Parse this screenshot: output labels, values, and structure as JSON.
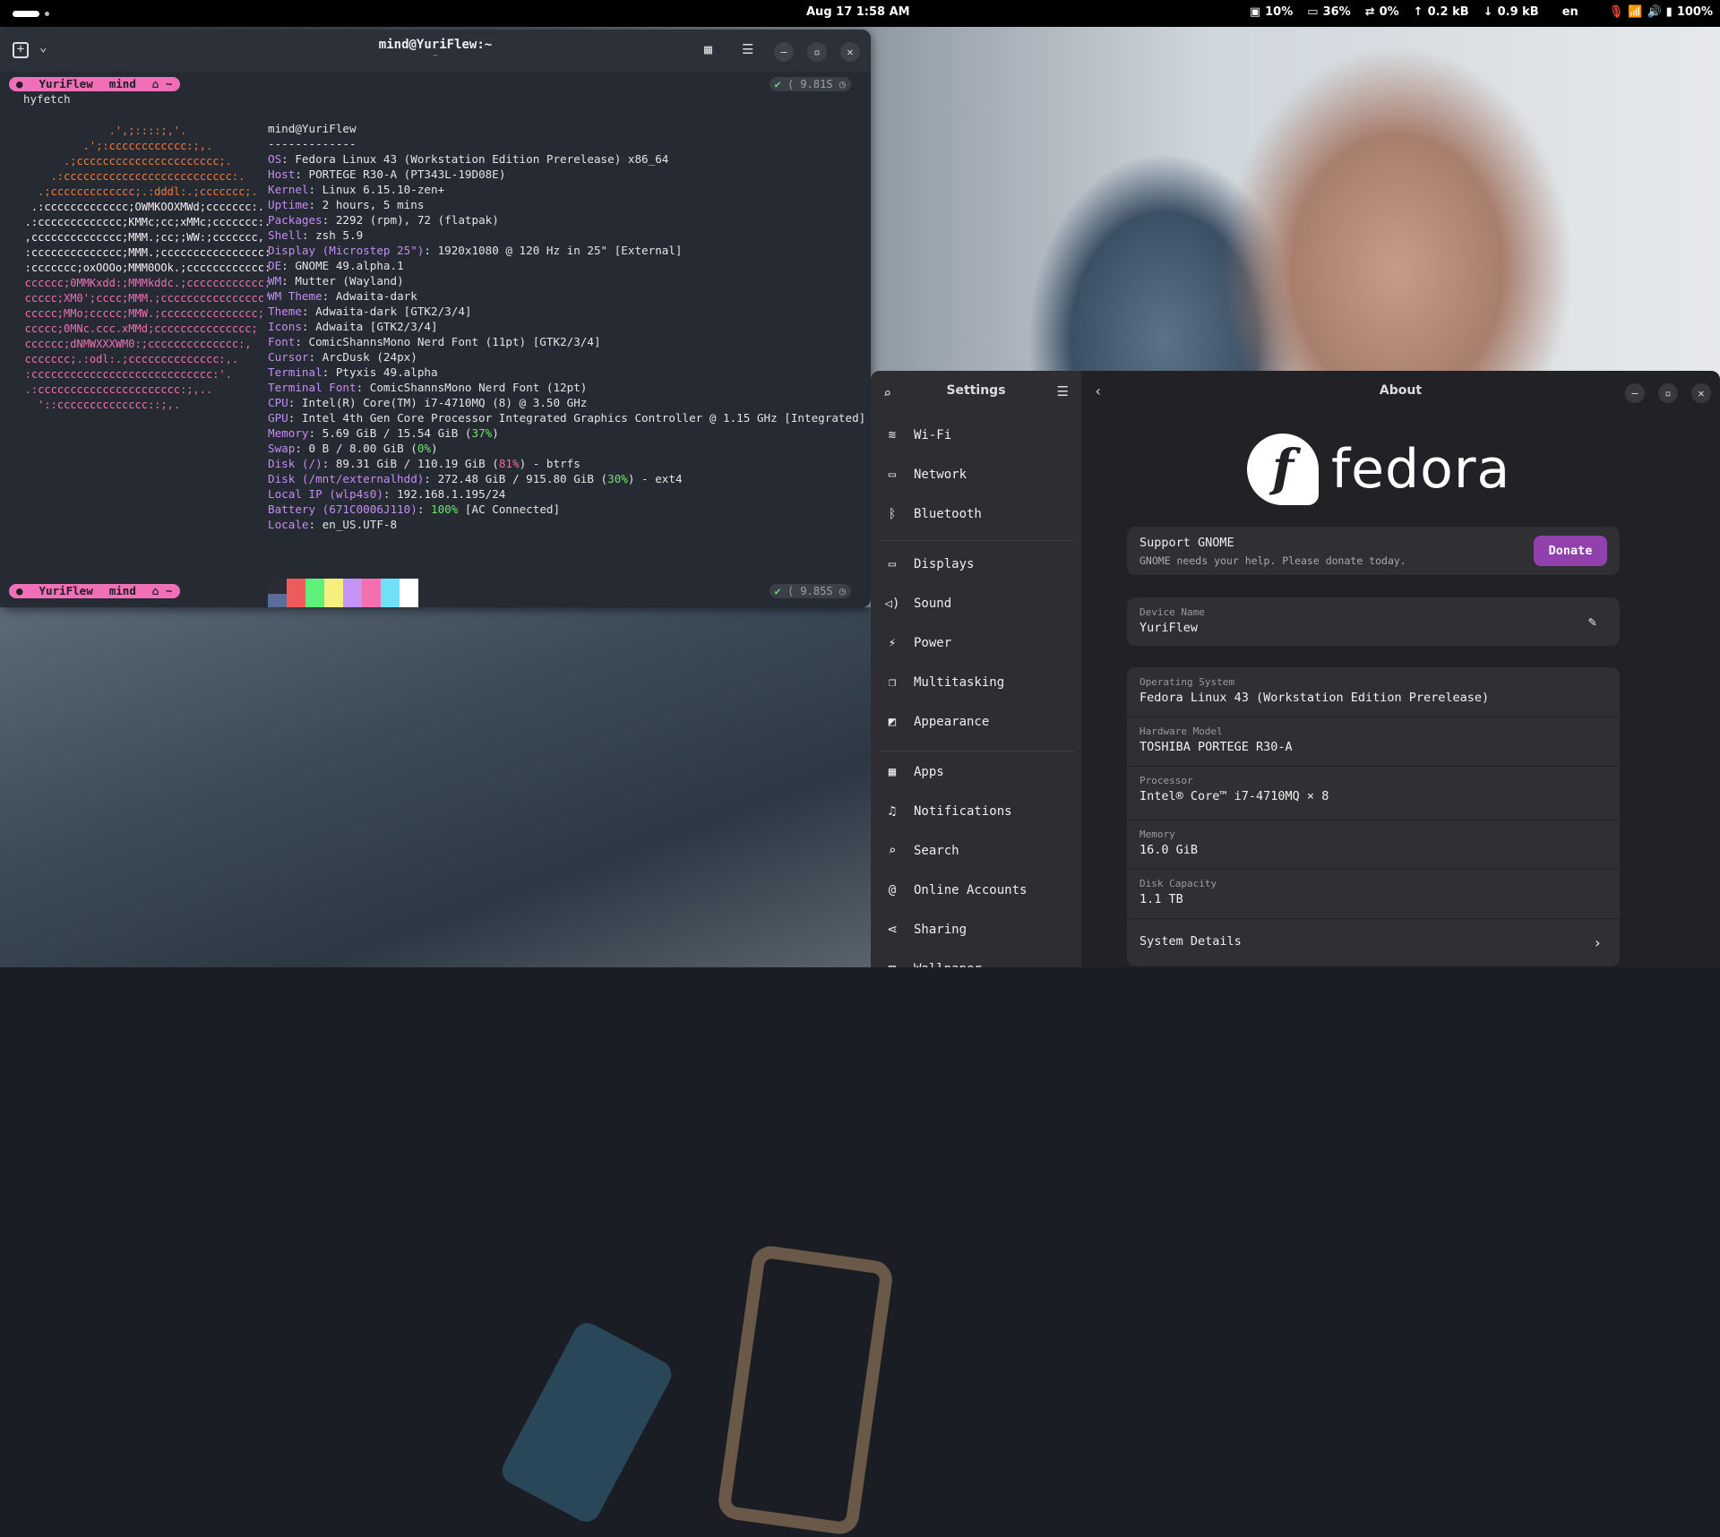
{
  "topbar": {
    "clock": "Aug 17  1:58 AM",
    "cpu": "10%",
    "memory": "36%",
    "swap": "0%",
    "net_up": "0.2 kB",
    "net_down": "0.9 kB",
    "language": "en",
    "battery": "100%"
  },
  "terminal": {
    "title": "mind@YuriFlew:~",
    "subtitle": "~",
    "prompt": {
      "host": "YuriFlew",
      "user": "mind",
      "dir": "~"
    },
    "status1": "9.81S",
    "status2": "9.85S",
    "command": "hyfetch",
    "logo_lines": [
      "                .',;::::;,'.",
      "            .';:cccccccccccc:;,.",
      "         .;cccccccccccccccccccccc;.",
      "       .:cccccccccccccccccccccccccc:.",
      "     .;ccccccccccccc;.:dddl:.;ccccccc;.",
      "    .:ccccccccccccc;OWMKOOXMWd;ccccccc:.",
      "   .:ccccccccccccc;KMMc;cc;xMMc;ccccccc:.",
      "   ,cccccccccccccc;MMM.;cc;;WW:;ccccccc,",
      "   :cccccccccccccc;MMM.;cccccccccccccccc:",
      "   :ccccccc;oxOOOo;MMM0OOk.;cccccccccccc:",
      "   cccccc;0MMKxdd:;MMMkddc.;cccccccccccc;",
      "   ccccc;XM0';cccc;MMM.;cccccccccccccccc'",
      "   ccccc;MMo;ccccc;MMW.;ccccccccccccccc;",
      "   ccccc;0MNc.ccc.xMMd;ccccccccccccccc;",
      "   cccccc;dNMWXXXWM0:;cccccccccccccc:,",
      "   ccccccc;.:odl:.;cccccccccccccc:,.",
      "   :cccccccccccccccccccccccccccc:'.",
      "   .:cccccccccccccccccccccc:;,..",
      "     '::cccccccccccccc::;,."
    ],
    "info": {
      "userhost": "mind@YuriFlew",
      "dashes": "-------------",
      "os": "Fedora Linux 43 (Workstation Edition Prerelease) x86_64",
      "host": "PORTEGE R30-A (PT343L-19D08E)",
      "kernel": "Linux 6.15.10-zen+",
      "uptime": "2 hours, 5 mins",
      "packages": "2292 (rpm), 72 (flatpak)",
      "shell": "zsh 5.9",
      "display_label": "Display (Microstep 25\")",
      "display": "1920x1080 @ 120 Hz in 25\" [External]",
      "de": "GNOME 49.alpha.1",
      "wm": "Mutter (Wayland)",
      "wm_theme": "Adwaita-dark",
      "theme": "Adwaita-dark [GTK2/3/4]",
      "icons": "Adwaita [GTK2/3/4]",
      "font": "ComicShannsMono Nerd Font (11pt) [GTK2/3/4]",
      "cursor": "ArcDusk (24px)",
      "terminal": "Ptyxis 49.alpha",
      "terminal_font": "ComicShannsMono Nerd Font (12pt)",
      "cpu": "Intel(R) Core(TM) i7-4710MQ (8) @ 3.50 GHz",
      "gpu": "Intel 4th Gen Core Processor Integrated Graphics Controller @ 1.15 GHz [Integrated]",
      "memory": "5.69 GiB / 15.54 GiB",
      "memory_pct": "37%",
      "swap": "0 B / 8.00 GiB",
      "swap_pct": "0%",
      "disk1_label": "Disk (/)",
      "disk1": "89.31 GiB / 110.19 GiB",
      "disk1_pct": "81%",
      "disk1_fs": "- btrfs",
      "disk2_label": "Disk (/mnt/externalhdd)",
      "disk2": "272.48 GiB / 915.80 GiB",
      "disk2_pct": "30%",
      "disk2_fs": "- ext4",
      "local_ip_label": "Local IP (wlp4s0)",
      "local_ip": "192.168.1.195/24",
      "battery_label": "Battery (671C0006J110)",
      "battery_pct": "100%",
      "battery_state": "[AC Connected]",
      "locale": "en_US.UTF-8"
    },
    "palette_top": [
      "#2b2b33",
      "#ef5b5b",
      "#5ef07a",
      "#f5f07d",
      "#c494f5",
      "#f36fb0",
      "#6fe0f5",
      "#ffffff"
    ],
    "palette_bottom": [
      "#5a6d9a",
      "#ef5b5b",
      "#5ef07a",
      "#f5f07d",
      "#c494f5",
      "#f36fb0",
      "#6fe0f5",
      "#ffffff"
    ]
  },
  "settings": {
    "sidebar_title": "Settings",
    "page_title": "About",
    "sidebar_items": [
      {
        "label": "Wi-Fi",
        "icon": "wifi-icon"
      },
      {
        "label": "Network",
        "icon": "network-icon"
      },
      {
        "label": "Bluetooth",
        "icon": "bluetooth-icon"
      },
      {
        "label": "Displays",
        "icon": "display-icon"
      },
      {
        "label": "Sound",
        "icon": "sound-icon"
      },
      {
        "label": "Power",
        "icon": "power-icon"
      },
      {
        "label": "Multitasking",
        "icon": "multitasking-icon"
      },
      {
        "label": "Appearance",
        "icon": "appearance-icon"
      },
      {
        "label": "Apps",
        "icon": "apps-icon"
      },
      {
        "label": "Notifications",
        "icon": "bell-icon"
      },
      {
        "label": "Search",
        "icon": "search-icon"
      },
      {
        "label": "Online Accounts",
        "icon": "at-icon"
      },
      {
        "label": "Sharing",
        "icon": "share-icon"
      },
      {
        "label": "Wallpaper",
        "icon": "wallpaper-icon"
      }
    ],
    "logo_word": "fedora",
    "support": {
      "title": "Support GNOME",
      "subtitle": "GNOME needs your help. Please donate today.",
      "button": "Donate"
    },
    "device_name_label": "Device Name",
    "device_name": "YuriFlew",
    "rows": [
      {
        "label": "Operating System",
        "value": "Fedora Linux 43 (Workstation Edition Prerelease)"
      },
      {
        "label": "Hardware Model",
        "value": "TOSHIBA PORTEGE R30-A"
      },
      {
        "label": "Processor",
        "value": "Intel® Core™ i7-4710MQ × 8"
      },
      {
        "label": "Memory",
        "value": "16.0 GiB"
      },
      {
        "label": "Disk Capacity",
        "value": "1.1 TB"
      }
    ],
    "system_details": "System Details",
    "accent": "#9141ac"
  }
}
